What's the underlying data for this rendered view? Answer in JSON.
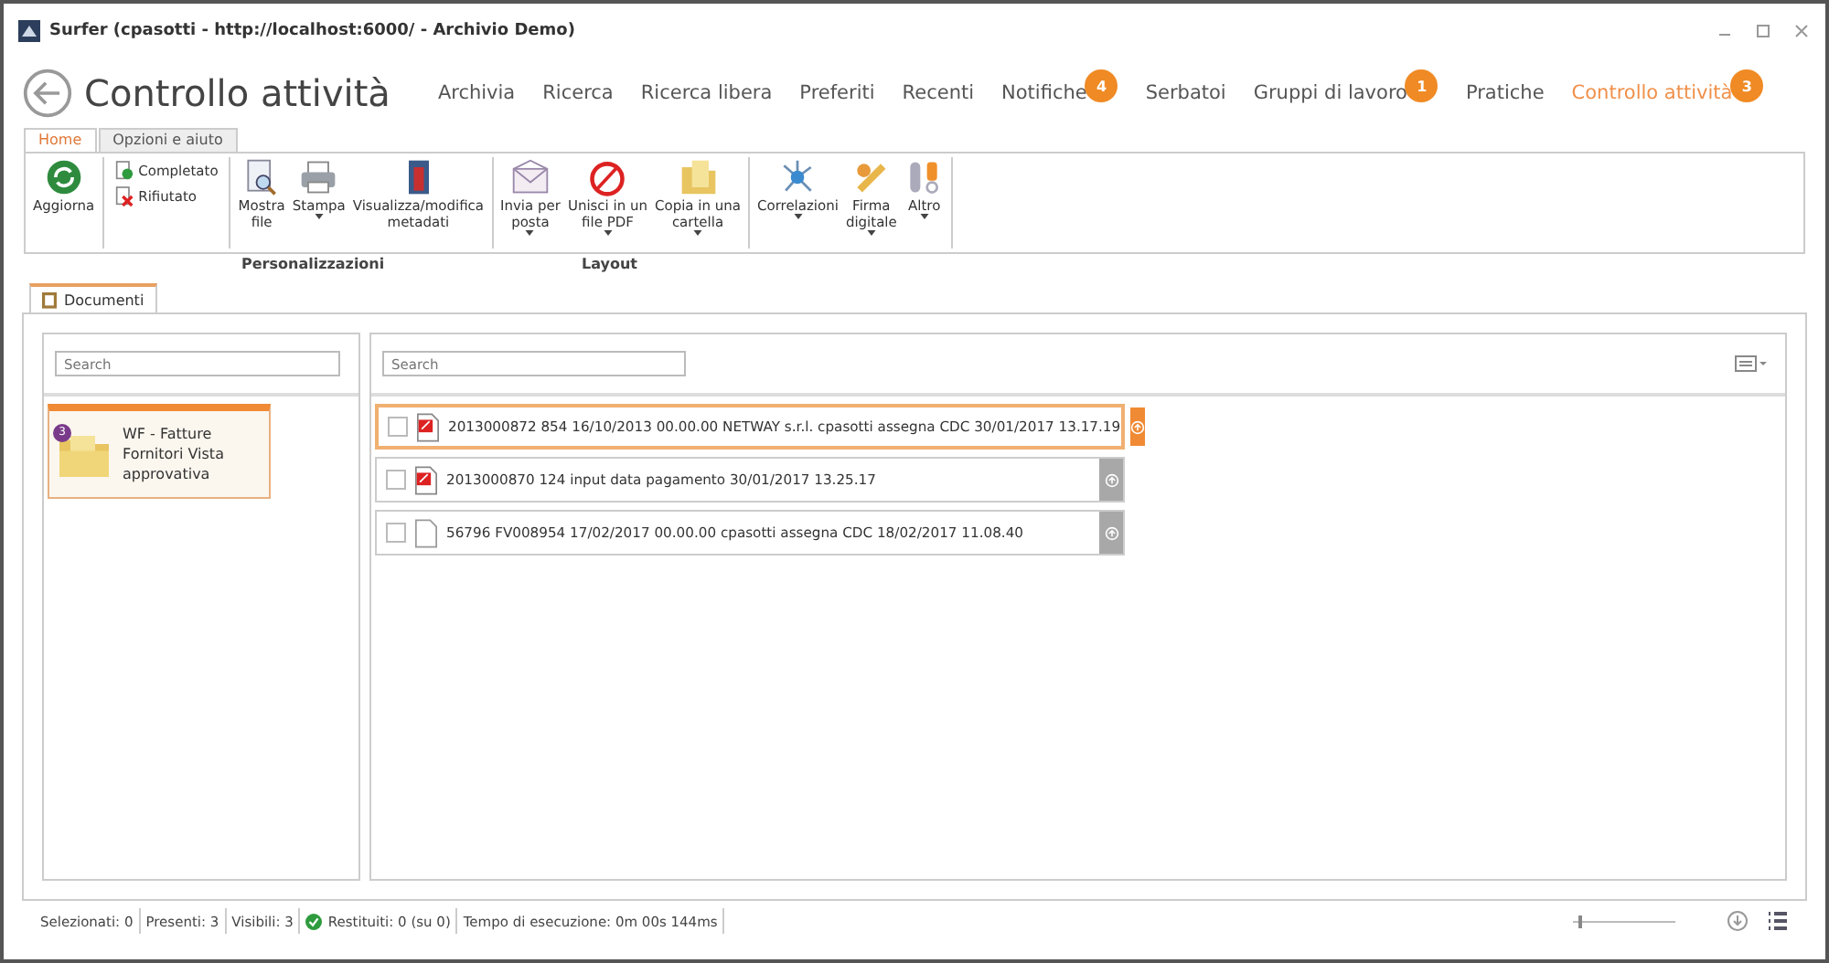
{
  "window": {
    "title": "Surfer (cpasotti - http://localhost:6000/ - Archivio Demo)"
  },
  "header": {
    "title": "Controllo attività"
  },
  "nav": [
    {
      "label": "Archivia",
      "selected": false
    },
    {
      "label": "Ricerca",
      "selected": false
    },
    {
      "label": "Ricerca libera",
      "selected": false
    },
    {
      "label": "Preferiti",
      "selected": false
    },
    {
      "label": "Recenti",
      "selected": false
    },
    {
      "label": "Notifiche",
      "selected": false,
      "badge": "4"
    },
    {
      "label": "Serbatoi",
      "selected": false
    },
    {
      "label": "Gruppi di lavoro",
      "selected": false,
      "badge": "1"
    },
    {
      "label": "Pratiche",
      "selected": false
    },
    {
      "label": "Controllo attività",
      "selected": true,
      "badge": "3"
    }
  ],
  "ribbon_tabs": [
    {
      "label": "Home",
      "selected": true
    },
    {
      "label": "Opzioni e aiuto",
      "selected": false
    }
  ],
  "ribbon": [
    [
      {
        "kind": "large",
        "label": "Aggiorna",
        "dropdown": false
      }
    ],
    [
      {
        "kind": "small",
        "label": "Completato"
      },
      {
        "kind": "small",
        "label": "Rifiutato"
      }
    ],
    [
      {
        "kind": "large",
        "label": "Mostra\nfile",
        "dropdown": false
      },
      {
        "kind": "large",
        "label": "Stampa",
        "dropdown": true
      },
      {
        "kind": "large",
        "label": "Visualizza/modifica\nmetadati",
        "dropdown": false
      }
    ],
    [
      {
        "kind": "large",
        "label": "Invia per\nposta",
        "dropdown": true
      },
      {
        "kind": "large",
        "label": "Unisci in un\nfile PDF",
        "dropdown": true
      },
      {
        "kind": "large",
        "label": "Copia in una\ncartella",
        "dropdown": true
      }
    ],
    [
      {
        "kind": "large",
        "label": "Correlazioni",
        "dropdown": true
      },
      {
        "kind": "large",
        "label": "Firma\ndigitale",
        "dropdown": true
      },
      {
        "kind": "large",
        "label": "Altro",
        "dropdown": true
      }
    ]
  ],
  "ribbon_group_labels": [
    "Personalizzazioni",
    "Layout"
  ],
  "doc_tabs": [
    {
      "label": "Documenti",
      "selected": true
    }
  ],
  "left_panel": {
    "search": {
      "placeholder": "Search"
    },
    "tiles": [
      {
        "label": "WF - Fatture Fornitori Vista approvativa",
        "badge": "3",
        "selected": true
      }
    ]
  },
  "right_panel": {
    "search": {
      "placeholder": "Search"
    },
    "rows": [
      {
        "text": "2013000872 854 16/10/2013 00.00.00 NETWAY s.r.l. cpasotti assegna CDC 30/01/2017 13.17.19",
        "kind": "pdf",
        "checked": false,
        "selected": true
      },
      {
        "text": "2013000870 124 input data pagamento 30/01/2017 13.25.17",
        "kind": "pdf",
        "checked": false,
        "selected": false
      },
      {
        "text": "56796 FV008954 17/02/2017 00.00.00 cpasotti assegna CDC 18/02/2017 11.08.40",
        "kind": "file",
        "checked": false,
        "selected": false
      }
    ]
  },
  "status_bar": [
    {
      "text": "Selezionati: 0",
      "ok": false
    },
    {
      "text": "Presenti: 3",
      "ok": false
    },
    {
      "text": "Visibili: 3",
      "ok": false
    },
    {
      "text": "Restituiti: 0 (su 0)",
      "ok": true
    },
    {
      "text": "Tempo di esecuzione: 0m 00s 144ms",
      "ok": false
    }
  ],
  "zoom_slider": {
    "level": 0.05
  }
}
